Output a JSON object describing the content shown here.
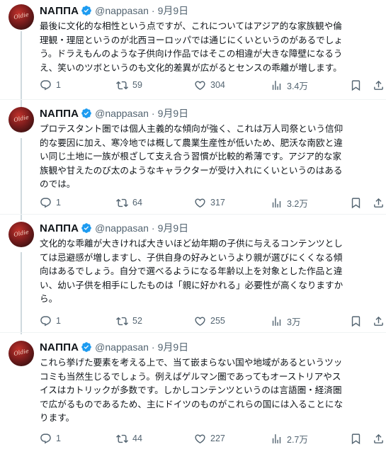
{
  "tweets": [
    {
      "name": "NAΠΠA",
      "handle": "@nappasan",
      "separator": "·",
      "date": "9月9日",
      "lines": [
        "最後に文化的な相性という点ですが、これについてはアジア的な家族観や倫",
        "理観・理屈というのが北西ヨーロッパでは通じにくいというのがあるでしょ",
        "う。ドラえもんのような子供向け作品ではそこの相違が大きな障壁になるう",
        "え、笑いのツボというのも文化的差異が広がるとセンスの乖離が増します。"
      ],
      "replies": "1",
      "reposts": "59",
      "likes": "304",
      "views": "3.4万"
    },
    {
      "name": "NAΠΠA",
      "handle": "@nappasan",
      "separator": "·",
      "date": "9月9日",
      "lines": [
        "プロテスタント圏では個人主義的な傾向が強く、これは万人司祭という信仰",
        "的な要因に加え、寒冷地では概して農業生産性が低いため、肥沃な南欧と違",
        "い同じ土地に一族が根ざして支え合う習慣が比較的希薄です。アジア的な家",
        "族観や甘えたのび太のようなキャラクターが受け入れにくいというのはある",
        "のでは。"
      ],
      "replies": "1",
      "reposts": "64",
      "likes": "317",
      "views": "3.2万"
    },
    {
      "name": "NAΠΠA",
      "handle": "@nappasan",
      "separator": "·",
      "date": "9月9日",
      "lines": [
        "文化的な乖離が大きければ大きいほど幼年期の子供に与えるコンテンツとし",
        "ては忌避感が増しますし、子供自身の好みというより親が選びにくくなる傾",
        "向はあるでしょう。自分で選べるようになる年齢以上を対象とした作品と違",
        "い、幼い子供を相手にしたものは「親に好かれる」必要性が高くなりますか",
        "ら。"
      ],
      "replies": "1",
      "reposts": "52",
      "likes": "255",
      "views": "3万"
    },
    {
      "name": "NAΠΠA",
      "handle": "@nappasan",
      "separator": "·",
      "date": "9月9日",
      "lines": [
        "これら挙げた要素を考える上で、当て嵌まらない国や地域があるというツッ",
        "コミも当然生じるでしょう。例えばゲルマン圏であってもオーストリアやス",
        "イスはカトリックが多数です。しかしコンテンツというのは言語圏・経済圏",
        "で広がるものであるため、主にドイツのものがこれらの国には入ることにな",
        "ります。"
      ],
      "replies": "1",
      "reposts": "44",
      "likes": "227",
      "views": "2.7万"
    }
  ],
  "colors": {
    "verified_badge": "#1d9bf0",
    "text_primary": "#0f1419",
    "text_secondary": "#536471",
    "thread_line": "#cfd9de"
  },
  "icons": [
    "verified-badge-icon",
    "reply-icon",
    "repost-icon",
    "like-icon",
    "views-icon",
    "bookmark-icon",
    "share-icon"
  ]
}
